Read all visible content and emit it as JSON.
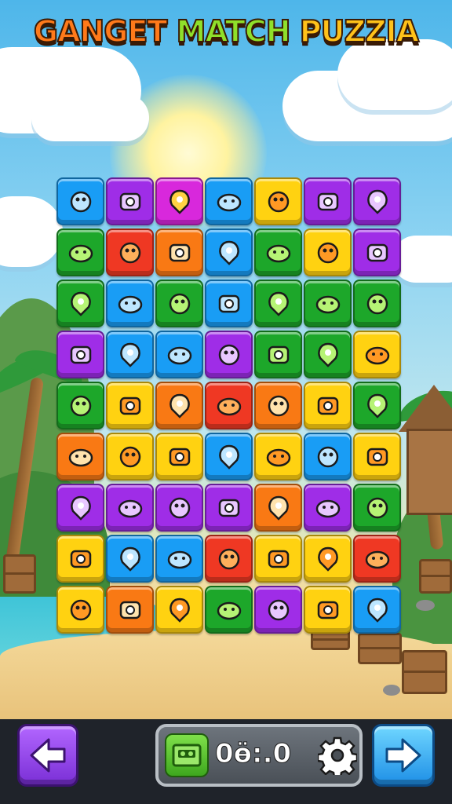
{
  "title": {
    "word1": "GANGET",
    "word2": "MATCH",
    "word3": "PUZZIA"
  },
  "colors": {
    "blue": "#1e9cf0",
    "purple": "#9b2fe0",
    "magenta": "#d22ad6",
    "yellow": "#ffd21a",
    "green": "#22a52e",
    "orange": "#f47a1a",
    "red": "#e83a26"
  },
  "grid": {
    "rows": [
      [
        {
          "color": "blue",
          "icon": "dolphin-icon"
        },
        {
          "color": "purple",
          "icon": "camera-lens-icon"
        },
        {
          "color": "magenta",
          "icon": "creature-icon"
        },
        {
          "color": "blue",
          "icon": "camera-icon"
        },
        {
          "color": "yellow",
          "icon": "star-icon"
        },
        {
          "color": "purple",
          "icon": "bug-icon"
        },
        {
          "color": "purple",
          "icon": "robot-face-icon"
        }
      ],
      [
        {
          "color": "green",
          "icon": "printer-icon"
        },
        {
          "color": "red",
          "icon": "balloon-icon"
        },
        {
          "color": "orange",
          "icon": "leaf-icon"
        },
        {
          "color": "blue",
          "icon": "speaker-icon"
        },
        {
          "color": "green",
          "icon": "gourd-icon"
        },
        {
          "color": "yellow",
          "icon": "crab-icon"
        },
        {
          "color": "purple",
          "icon": "pin-icon"
        }
      ],
      [
        {
          "color": "green",
          "icon": "letter-b-icon"
        },
        {
          "color": "blue",
          "icon": "disc-icon"
        },
        {
          "color": "green",
          "icon": "camera-icon"
        },
        {
          "color": "blue",
          "icon": "radio-icon"
        },
        {
          "color": "green",
          "icon": "speech-icon"
        },
        {
          "color": "green",
          "icon": "bottle-icon"
        },
        {
          "color": "green",
          "icon": "shell-icon"
        }
      ],
      [
        {
          "color": "purple",
          "icon": "robot-icon"
        },
        {
          "color": "blue",
          "icon": "projector-icon"
        },
        {
          "color": "blue",
          "icon": "giraffe-icon"
        },
        {
          "color": "purple",
          "icon": "wand-icon"
        },
        {
          "color": "green",
          "icon": "cloud-icon"
        },
        {
          "color": "green",
          "icon": "grape-icon"
        },
        {
          "color": "yellow",
          "icon": "basketball-icon"
        }
      ],
      [
        {
          "color": "green",
          "icon": "blob-icon"
        },
        {
          "color": "yellow",
          "icon": "mushroom-icon"
        },
        {
          "color": "orange",
          "icon": "scroll-icon"
        },
        {
          "color": "red",
          "icon": "potato-icon"
        },
        {
          "color": "orange",
          "icon": "battery-icon"
        },
        {
          "color": "yellow",
          "icon": "jar-icon"
        },
        {
          "color": "green",
          "icon": "ring-icon"
        }
      ],
      [
        {
          "color": "orange",
          "icon": "bean-icon"
        },
        {
          "color": "yellow",
          "icon": "apple-icon"
        },
        {
          "color": "yellow",
          "icon": "washer-icon"
        },
        {
          "color": "blue",
          "icon": "shield-icon"
        },
        {
          "color": "yellow",
          "icon": "cookie-icon"
        },
        {
          "color": "blue",
          "icon": "lollipop-icon"
        },
        {
          "color": "yellow",
          "icon": "macaron-icon"
        }
      ],
      [
        {
          "color": "purple",
          "icon": "location-pin-icon"
        },
        {
          "color": "purple",
          "icon": "beetle-icon"
        },
        {
          "color": "purple",
          "icon": "robot-arm-icon"
        },
        {
          "color": "purple",
          "icon": "notepad-icon"
        },
        {
          "color": "orange",
          "icon": "jar-icon"
        },
        {
          "color": "purple",
          "icon": "hammer-icon"
        },
        {
          "color": "green",
          "icon": "cheese-icon"
        }
      ],
      [
        {
          "color": "yellow",
          "icon": "bucket-icon"
        },
        {
          "color": "blue",
          "icon": "balloon-icon"
        },
        {
          "color": "blue",
          "icon": "heart-icon"
        },
        {
          "color": "red",
          "icon": "speech-bubble-icon"
        },
        {
          "color": "yellow",
          "icon": "speech-bubble-icon"
        },
        {
          "color": "yellow",
          "icon": "football-icon"
        },
        {
          "color": "red",
          "icon": "speech-bubble-icon"
        }
      ],
      [
        {
          "color": "yellow",
          "icon": "drop-icon"
        },
        {
          "color": "orange",
          "icon": "hand-icon"
        },
        {
          "color": "yellow",
          "icon": "avocado-icon"
        },
        {
          "color": "green",
          "icon": "bear-face-icon"
        },
        {
          "color": "purple",
          "icon": "skull-icon"
        },
        {
          "color": "yellow",
          "icon": "frog-icon"
        },
        {
          "color": "blue",
          "icon": "location-pin-icon"
        }
      ]
    ]
  },
  "bottom_bar": {
    "back_icon": "arrow-left-icon",
    "next_icon": "arrow-right-icon",
    "panel_icon": "cassette-icon",
    "score_text": "0ӫ:.0",
    "settings_icon": "gear-icon"
  }
}
